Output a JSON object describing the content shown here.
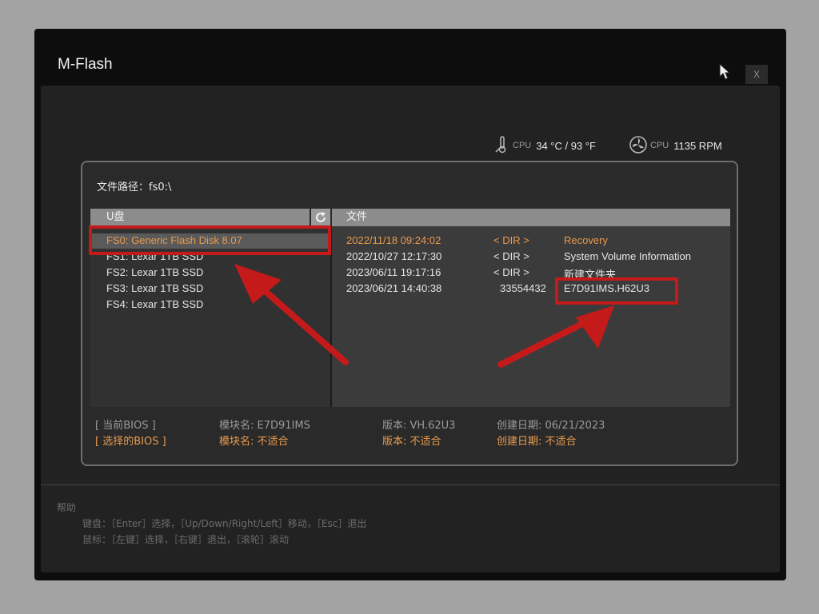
{
  "window": {
    "title": "M-Flash",
    "close_label": "X"
  },
  "sensors": {
    "cpu_temp_label": "CPU",
    "cpu_temp_value": "34 °C / 93 °F",
    "cpu_fan_label": "CPU",
    "cpu_fan_value": "1135 RPM"
  },
  "path": {
    "label": "文件路径：",
    "value": "fs0:\\"
  },
  "usb": {
    "header": "U盘",
    "devices": [
      {
        "label": "FS0: Generic Flash Disk 8.07",
        "selected": true
      },
      {
        "label": "FS1: Lexar 1TB SSD",
        "selected": false
      },
      {
        "label": "FS2: Lexar 1TB SSD",
        "selected": false
      },
      {
        "label": "FS3: Lexar 1TB SSD",
        "selected": false
      },
      {
        "label": "FS4: Lexar 1TB SSD",
        "selected": false
      }
    ]
  },
  "files": {
    "header": "文件",
    "rows": [
      {
        "date": "2022/11/18 09:24:02",
        "size": "< DIR >",
        "name": "Recovery",
        "selected": true
      },
      {
        "date": "2022/10/27 12:17:30",
        "size": "< DIR >",
        "name": "System Volume Information",
        "selected": false
      },
      {
        "date": "2023/06/11 19:17:16",
        "size": "< DIR >",
        "name": "新建文件夹",
        "selected": false
      },
      {
        "date": "2023/06/21 14:40:38",
        "size": "33554432",
        "name": "E7D91IMS.H62U3",
        "selected": false
      }
    ]
  },
  "bios": {
    "current": {
      "label": "[    当前BIOS    ]",
      "module": "模块名: E7D91IMS",
      "version": "版本: VH.62U3",
      "date": "创建日期: 06/21/2023"
    },
    "selected": {
      "label": "[   选择的BIOS   ]",
      "module": "模块名: 不适合",
      "version": "版本: 不适合",
      "date": "创建日期: 不适合"
    }
  },
  "help": {
    "title": "帮助",
    "keyboard": "键盘：［Enter］选择，［Up/Down/Right/Left］移动，［Esc］退出",
    "mouse": "鼠标：［左键］选择，［右键］退出，［滚轮］滚动"
  },
  "colors": {
    "accent": "#e99a4f",
    "annotation": "#c41a1a"
  }
}
